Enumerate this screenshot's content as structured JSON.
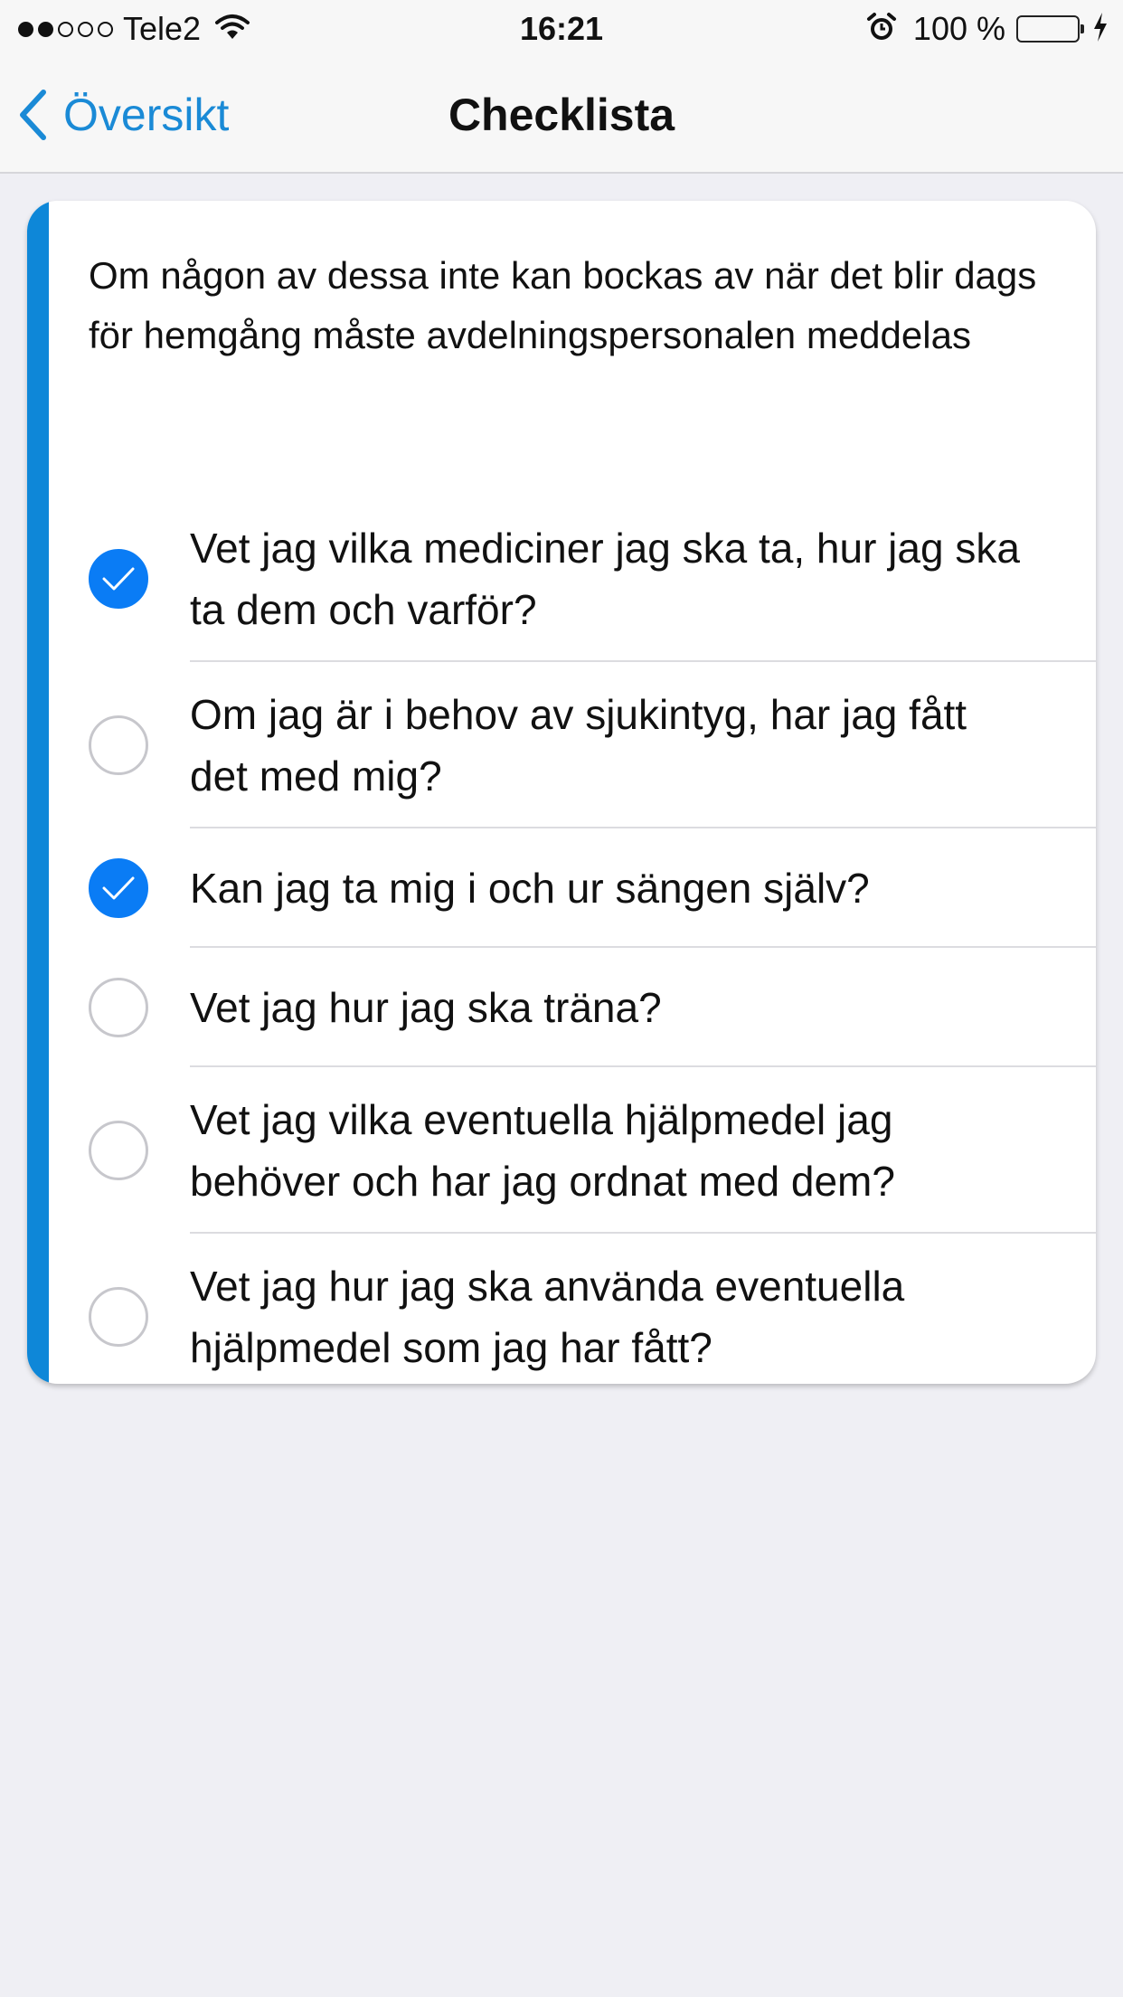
{
  "status_bar": {
    "carrier": "Tele2",
    "signal_dots_filled": 2,
    "signal_dots_total": 5,
    "time": "16:21",
    "battery_percent": "100 %",
    "icons": [
      "wifi-icon",
      "alarm-icon",
      "battery-icon",
      "charging-icon"
    ],
    "battery_color": "#4cd964"
  },
  "nav": {
    "back_label": "Översikt",
    "title": "Checklista",
    "accent_color": "#1a8ad6"
  },
  "card": {
    "accent_color": "#0e87d8",
    "intro": "Om någon av dessa inte kan bockas av när det blir dags för hemgång måste avdelningspersonalen meddelas",
    "items": [
      {
        "label": "Vet jag vilka mediciner jag ska ta, hur jag ska ta dem och varför?",
        "checked": true
      },
      {
        "label": "Om jag är i behov av sjukintyg, har jag fått det med mig?",
        "checked": false
      },
      {
        "label": "Kan jag ta mig i och ur sängen själv?",
        "checked": true
      },
      {
        "label": "Vet jag hur jag ska träna?",
        "checked": false
      },
      {
        "label": "Vet jag vilka eventuella hjälpmedel jag behöver och har jag ordnat med dem?",
        "checked": false
      },
      {
        "label": "Vet jag hur jag ska använda eventuella hjälpmedel som jag har fått?",
        "checked": false
      }
    ],
    "check_color": "#0a7cf5"
  }
}
